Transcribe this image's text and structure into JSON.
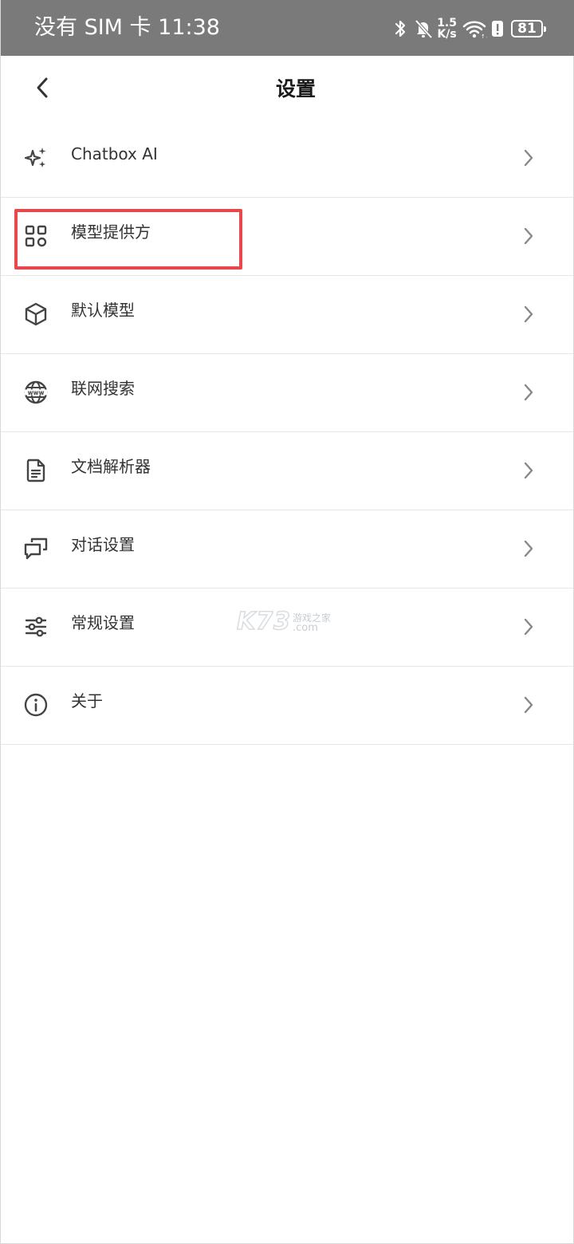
{
  "status_bar": {
    "left_text": "没有 SIM 卡 11:38",
    "net_speed_value": "1.5",
    "net_speed_unit": "K/s",
    "battery_level": "81",
    "icons": [
      "bluetooth-icon",
      "bell-muted-icon",
      "wifi-icon",
      "battery-alert-icon",
      "battery-icon"
    ]
  },
  "app_bar": {
    "title": "设置",
    "back_icon": "chevron-left-icon"
  },
  "settings_items": [
    {
      "label": "Chatbox AI",
      "icon": "sparkles-icon"
    },
    {
      "label": "模型提供方",
      "icon": "grid-apps-icon",
      "highlighted": true
    },
    {
      "label": "默认模型",
      "icon": "cube-icon"
    },
    {
      "label": "联网搜索",
      "icon": "globe-www-icon"
    },
    {
      "label": "文档解析器",
      "icon": "document-icon"
    },
    {
      "label": "对话设置",
      "icon": "chat-bubbles-icon"
    },
    {
      "label": "常规设置",
      "icon": "sliders-icon"
    },
    {
      "label": "关于",
      "icon": "info-icon"
    }
  ],
  "watermark": {
    "brand": "K73",
    "site_name": "游戏之家",
    "domain": ".com"
  },
  "colors": {
    "status_bar_bg": "#7a7a7a",
    "highlight_border": "#e8474c",
    "text_primary": "#333333",
    "icon_color": "#444444",
    "divider": "#e6e6e6"
  }
}
